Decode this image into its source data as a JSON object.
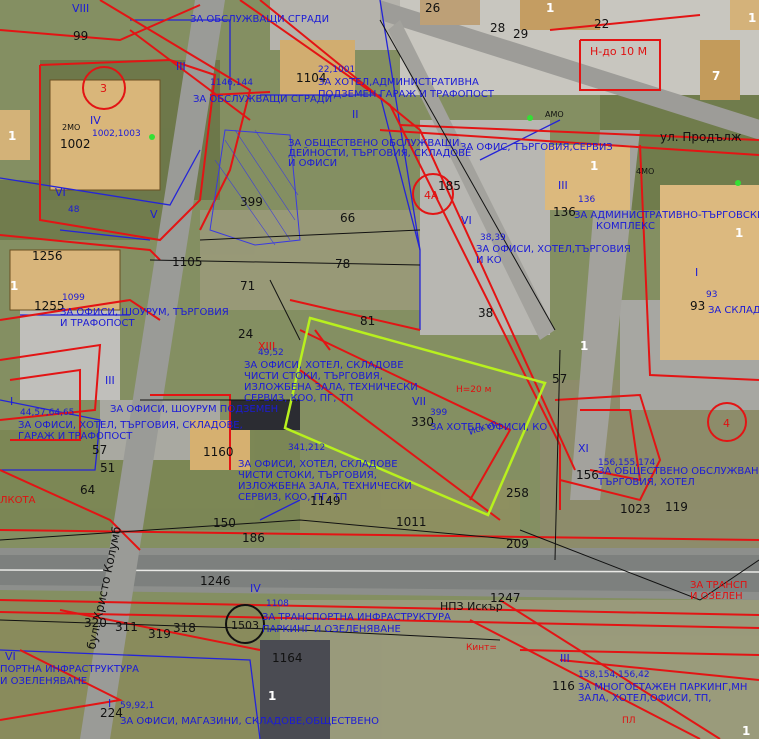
{
  "streets": {
    "top_right": "ул. Продълж",
    "bottom_left_vertical": "бул. Христо Колумб"
  },
  "stop_label": "НПЗ Искър",
  "circle_markers": [
    "3",
    "4А",
    "4",
    "1503"
  ],
  "plot_numbers": {
    "p1002": "1002",
    "p1104": "1104",
    "p1256": "1256",
    "p1255": "1255",
    "p1105": "1105",
    "p1160": "1160",
    "p1149": "1149",
    "p1011": "1011",
    "p1023": "1023",
    "p185": "185",
    "p136": "136",
    "p93": "93",
    "p156": "156",
    "p66": "66",
    "p38": "38",
    "p81": "81",
    "p399": "399",
    "p330": "330",
    "p258": "258",
    "p209": "209",
    "p186": "186",
    "p1246": "1246",
    "p1247": "1247",
    "p1164": "1164",
    "p116": "116",
    "p224": "224",
    "p319": "319",
    "p318": "318",
    "p320": "320",
    "p311": "311",
    "p119": "119",
    "p57": "57",
    "p99": "99",
    "p26": "26",
    "p28": "28",
    "p29": "29",
    "p22": "22",
    "p7": "7",
    "p1a": "1",
    "p1b": "1",
    "p1c": "1",
    "p1d": "1",
    "p1e": "1",
    "p1f": "1",
    "p1g": "1",
    "p1h": "1",
    "p1i": "1",
    "p71": "71",
    "p78": "78",
    "p64": "64",
    "p57b": "57",
    "p51": "51",
    "p150": "150",
    "p24": "24"
  },
  "zone_labels": {
    "z1": "ЗА ХОТЕЛ,АДМИНИСТРАТИВНА",
    "z2": "ПОДЗЕМЕН ГАРАЖ И ТРАФОПОСТ",
    "z3": "ЗА ОБЩЕСТВЕНО ОБСЛУЖВАЩИ",
    "z4": "ДЕЙНОСТИ, ТЪРГОВИЯ, СКЛАДОВЕ",
    "z5": "И ОФИСИ",
    "z6": "ЗА ОФИС, ТЪРГОВИЯ,СЕРВИЗ",
    "z7": "ЗА АДМИНИСТРАТИВНО-ТЪРГОВСКИ",
    "z8": "КОМПЛЕКС",
    "z9": "ЗА ОФИСИ, ХОТЕЛ,ТЪРГОВИЯ",
    "z10": "И КО",
    "z11": "ЗА ОФИСИ, ШОУРУМ, ТЪРГОВИЯ",
    "z12": "И ТРАФОПОСТ",
    "z13": "ЗА СКЛАДОВЕ",
    "z14": "ЗА ОФИСИ, ХОТЕЛ, СКЛАДОВЕ",
    "z15": "ЧИСТИ СТОКИ, ТЪРГОВИЯ,",
    "z16": "ИЗЛОЖБЕНА ЗАЛА, ТЕХНИЧЕСКИ",
    "z17": "СЕРВИЗ, КОО, ПГ, ТП",
    "z18": "ЗА ОФИСИ, ХОТЕЛ, СКЛАДОВЕ",
    "z19": "ЧИСТИ СТОКИ, ТЪРГОВИЯ,",
    "z20": "ИЗЛОЖБЕНА ЗАЛА, ТЕХНИЧЕСКИ",
    "z21": "СЕРВИЗ, КОО, ПГ, ТП",
    "z22": "ЗА ХОТЕЛ, ОФИСИ, КО",
    "z23": "ЗА ОБЩЕСТВЕНО ОБСЛУЖВАНЕ",
    "z24": "ТЪРГОВИЯ, ХОТЕЛ",
    "z25": "ЗА ОФИСИ, ХОТЕЛ, ТЪРГОВИЯ, СКЛАДОВЕ,",
    "z26": "ГАРАЖ И ТРАФОПОСТ",
    "z27": "ЗА ТРАНСПОРТНА ИНФРАСТРУКТУРА",
    "z28": "ПАРКИНГ И ОЗЕЛЕНЯВАНЕ",
    "z29": "ЗА ТРАНСП",
    "z30": "И ОЗЕЛЕН",
    "z31": "ЗА МНОГОЕТАЖЕН ПАРКИНГ,МН",
    "z32": "ЗАЛА, ХОТЕЛ,ОФИСИ, ТП, ",
    "z33": "ЗА ОФИСИ, МАГАЗИНИ, СКЛАДОВЕ,ОБЩЕСТВЕНО",
    "z34": "ПОРТНА ИНФРАСТРУКТУРА",
    "z35": "И ОЗЕЛЕНЯВАНЕ",
    "z36": "ЗА ОБСЛУЖВАЩИ СГРАДИ",
    "z37": "ЗА ОБСЛУЖВАЩИ СГРАДИ",
    "z38": "ЗА ОФИСИ, ШОУРУМ ПОДЗЕМЕН"
  },
  "codes": {
    "c1": "IV",
    "c2": "VI",
    "c3": "V",
    "c4": "III",
    "c5": "II",
    "c6": "VI",
    "c7": "VII",
    "c8": "XI",
    "c9": "XIII",
    "c10": "I",
    "c11": "III",
    "c12": "III",
    "c13": "IV",
    "c14": "VI",
    "c15": "VIII",
    "c16": "I",
    "c17": "I",
    "c18": "III"
  },
  "small_codes": {
    "s1": "1002,1003",
    "s2": "22,1001",
    "s3": "38,39",
    "s4": "136",
    "s5": "93",
    "s6": "48",
    "s7": "1099",
    "s8": "341,212",
    "s9": "156,155,174",
    "s10": "158,154,156,42",
    "s11": "59,92,1",
    "s12": "1108",
    "s13": "44,57,64,65",
    "s14": "399",
    "s15": "49,52",
    "s16": "1146,144"
  },
  "small_red": {
    "r1": "Н-до 10 М",
    "r2": "2МО",
    "r3": "АМО",
    "r4": "4МО",
    "r5": "Н=20 м",
    "r6": "Кинт=",
    "r7": "ПЛ",
    "r8": "ЛКОТА"
  },
  "highlight_label": "Искър"
}
